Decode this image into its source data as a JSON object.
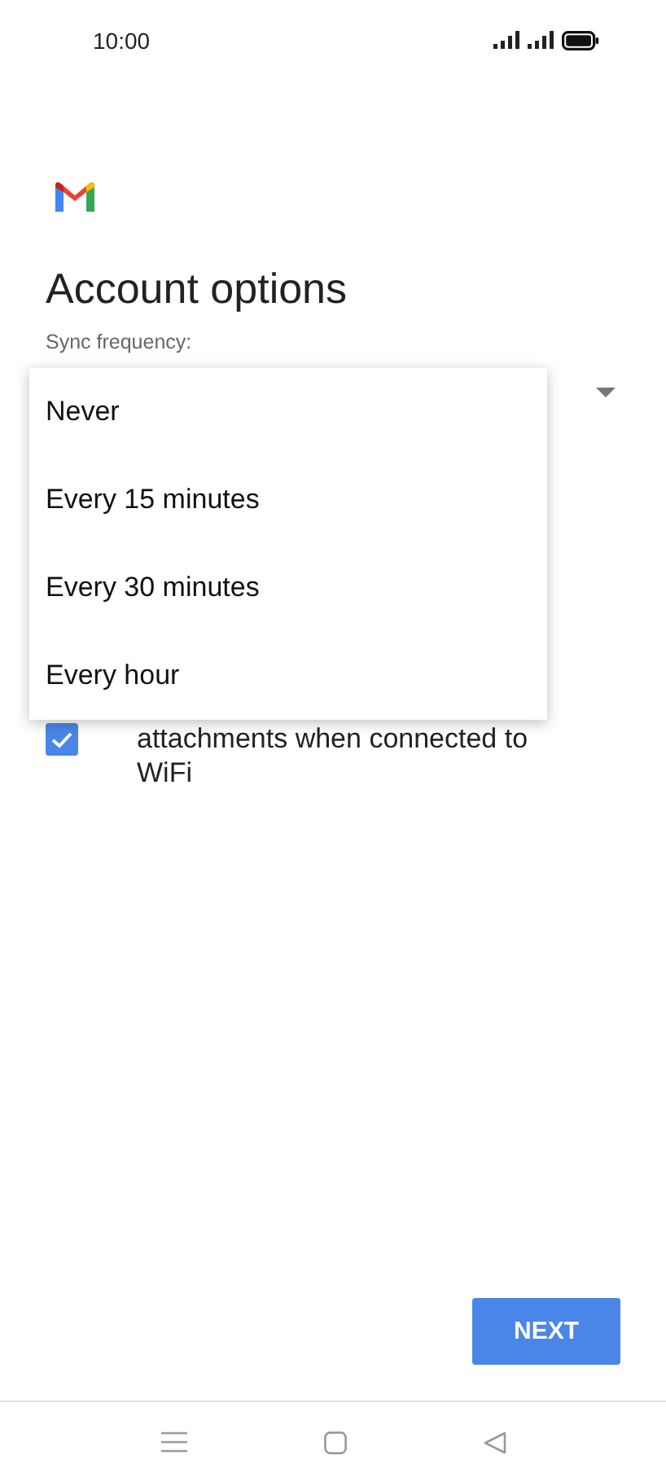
{
  "status_bar": {
    "time": "10:00"
  },
  "title": "Account options",
  "sync_frequency": {
    "label": "Sync frequency:",
    "menu": {
      "expanded": true,
      "options": [
        {
          "label": "Never"
        },
        {
          "label": "Every 15 minutes"
        },
        {
          "label": "Every 30 minutes"
        },
        {
          "label": "Every hour"
        }
      ]
    }
  },
  "wifi_attachments": {
    "label": "attachments when connected to WiFi",
    "checked": true
  },
  "next_button": "NEXT"
}
